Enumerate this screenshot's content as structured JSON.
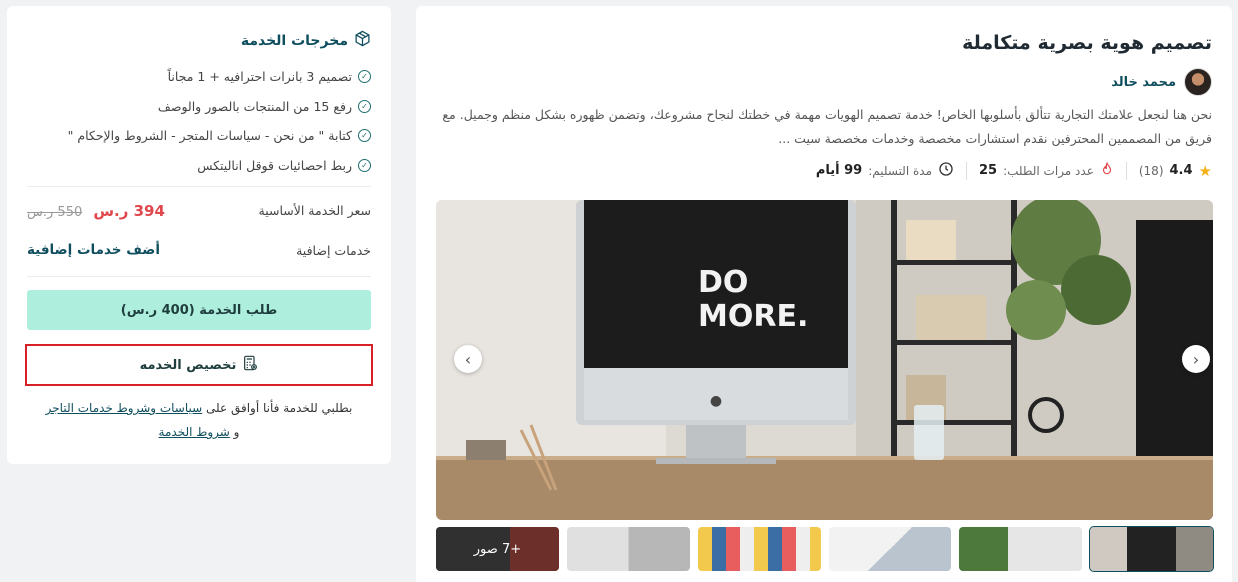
{
  "service": {
    "title": "تصميم هوية بصرية متكاملة",
    "seller_name": "محمد خالد",
    "description": "نحن هنا لنجعل علامتك التجارية تتألق بأسلوبها الخاص! خدمة تصميم الهويات مهمة في خطتك لنجاح مشروعك، وتضمن ظهوره بشكل منظم وجميل. مع فريق من المصممين المحترفين نقدم استشارات مخصصة وخدمات مخصصة سيت ...",
    "rating": "4.4",
    "rating_count": "(18)",
    "orders_label": "عدد مرات الطلب:",
    "orders_value": "25",
    "delivery_label": "مدة التسليم:",
    "delivery_value": "99 أيام",
    "gallery": {
      "main_image_text": [
        "DO",
        "MORE."
      ],
      "more_photos_label": "+7 صور"
    }
  },
  "sidebar": {
    "outputs_title": "مخرجات الخدمة",
    "outputs": [
      "تصميم 3 بانرات احترافيه + 1 مجاناً",
      "رفع 15 من المنتجات بالصور والوصف",
      "كتابة \" من نحن - سياسات المتجر - الشروط والإحكام \"",
      "ربط احصائيات قوقل اناليتكس"
    ],
    "base_price_label": "سعر الخدمة الأساسية",
    "price_new": "394 ر.س",
    "price_old": "550 ر.س",
    "extras_label": "خدمات إضافية",
    "extras_link": "أضف خدمات إضافية",
    "order_button": "طلب الخدمة (400 ر.س)",
    "customize_button": "تخصيص الخدمه",
    "terms_prefix": "بطلبي للخدمة فأنا أوافق على",
    "terms_link1": "سياسات وشروط خدمات التاجر",
    "terms_and": "و",
    "terms_link2": "شروط الخدمة"
  },
  "colors": {
    "brand": "#0f4e5e",
    "price_red": "#e0474c",
    "order_button_bg": "#aeeedd",
    "highlight_border": "#d62128",
    "star": "#f6b21a"
  }
}
